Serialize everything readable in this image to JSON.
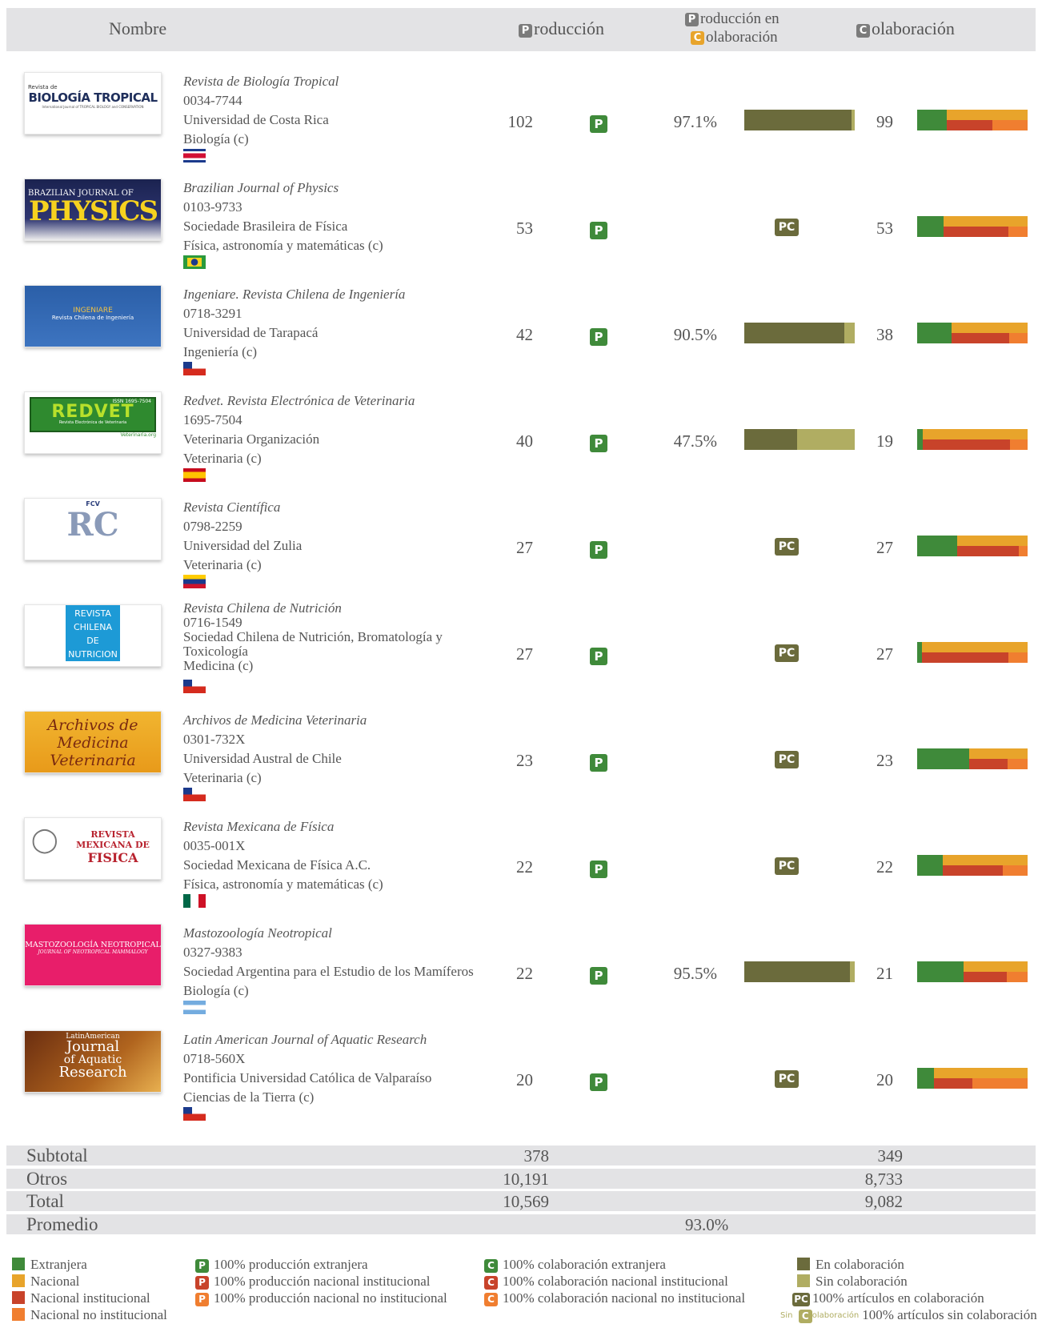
{
  "header": {
    "nombre": "Nombre",
    "produccion_badge": "P",
    "produccion": "roducción",
    "prodcolab_badge1": "P",
    "prodcolab_line1": "roducción en",
    "prodcolab_badge2": "C",
    "prodcolab_line2": "olaboración",
    "colab_badge": "C",
    "colab": "olaboración"
  },
  "badges": {
    "p": "P",
    "pc": "PC"
  },
  "journals": [
    {
      "title": "Revista de Biología Tropical",
      "issn": "0034-7744",
      "institution": "Universidad de Costa Rica",
      "area": "Biología (c)",
      "country_flag": "costa-rica-flag",
      "produccion": "102",
      "prod_colab_pct": "97.1%",
      "prod_colab_value": 0.971,
      "colaboracion": "99",
      "colab_bar": {
        "extranjera": 0.27,
        "nacional": 0.73,
        "nacional_institucional": 0.41,
        "nacional_no_institucional": 0.32
      }
    },
    {
      "title": "Brazilian Journal of Physics",
      "issn": "0103-9733",
      "institution": "Sociedade Brasileira de Física",
      "area": "Física, astronomía y matemáticas (c)",
      "country_flag": "brazil-flag",
      "produccion": "53",
      "prod_colab_pct": "",
      "prod_colab_value": 1.0,
      "colaboracion": "53",
      "colab_bar": {
        "extranjera": 0.24,
        "nacional": 0.76,
        "nacional_institucional": 0.59,
        "nacional_no_institucional": 0.17
      }
    },
    {
      "title": "Ingeniare. Revista Chilena de Ingeniería",
      "issn": "0718-3291",
      "institution": "Universidad de Tarapacá",
      "area": "Ingeniería (c)",
      "country_flag": "chile-flag",
      "produccion": "42",
      "prod_colab_pct": "90.5%",
      "prod_colab_value": 0.905,
      "colaboracion": "38",
      "colab_bar": {
        "extranjera": 0.31,
        "nacional": 0.69,
        "nacional_institucional": 0.52,
        "nacional_no_institucional": 0.17
      }
    },
    {
      "title": "Redvet. Revista Electrónica de Veterinaria",
      "issn": "1695-7504",
      "institution": "Veterinaria Organización",
      "area": "Veterinaria (c)",
      "country_flag": "spain-flag",
      "produccion": "40",
      "prod_colab_pct": "47.5%",
      "prod_colab_value": 0.475,
      "colaboracion": "19",
      "colab_bar": {
        "extranjera": 0.05,
        "nacional": 0.95,
        "nacional_institucional": 0.79,
        "nacional_no_institucional": 0.16
      }
    },
    {
      "title": "Revista Científica",
      "issn": "0798-2259",
      "institution": "Universidad del Zulia",
      "area": "Veterinaria (c)",
      "country_flag": "venezuela-flag",
      "produccion": "27",
      "prod_colab_pct": "",
      "prod_colab_value": 1.0,
      "colaboracion": "27",
      "colab_bar": {
        "extranjera": 0.36,
        "nacional": 0.64,
        "nacional_institucional": 0.56,
        "nacional_no_institucional": 0.08
      }
    },
    {
      "title": "Revista Chilena de Nutrición",
      "issn": "0716-1549",
      "institution": "Sociedad Chilena de Nutrición, Bromatología y Toxicología",
      "area": "Medicina (c)",
      "country_flag": "chile-flag",
      "produccion": "27",
      "prod_colab_pct": "",
      "prod_colab_value": 1.0,
      "colaboracion": "27",
      "colab_bar": {
        "extranjera": 0.04,
        "nacional": 0.96,
        "nacional_institucional": 0.78,
        "nacional_no_institucional": 0.18
      }
    },
    {
      "title": "Archivos de Medicina Veterinaria",
      "issn": "0301-732X",
      "institution": "Universidad Austral de Chile",
      "area": "Veterinaria (c)",
      "country_flag": "chile-flag",
      "produccion": "23",
      "prod_colab_pct": "",
      "prod_colab_value": 1.0,
      "colaboracion": "23",
      "colab_bar": {
        "extranjera": 0.47,
        "nacional": 0.53,
        "nacional_institucional": 0.35,
        "nacional_no_institucional": 0.18
      }
    },
    {
      "title": "Revista Mexicana de Física",
      "issn": "0035-001X",
      "institution": "Sociedad Mexicana de Física A.C.",
      "area": "Física, astronomía y matemáticas (c)",
      "country_flag": "mexico-flag",
      "produccion": "22",
      "prod_colab_pct": "",
      "prod_colab_value": 1.0,
      "colaboracion": "22",
      "colab_bar": {
        "extranjera": 0.23,
        "nacional": 0.77,
        "nacional_institucional": 0.54,
        "nacional_no_institucional": 0.23
      }
    },
    {
      "title": "Mastozoología Neotropical",
      "issn": "0327-9383",
      "institution": "Sociedad Argentina para el Estudio de los Mamíferos",
      "area": "Biología (c)",
      "country_flag": "argentina-flag",
      "produccion": "22",
      "prod_colab_pct": "95.5%",
      "prod_colab_value": 0.955,
      "colaboracion": "21",
      "colab_bar": {
        "extranjera": 0.42,
        "nacional": 0.58,
        "nacional_institucional": 0.39,
        "nacional_no_institucional": 0.19
      }
    },
    {
      "title": "Latin American Journal of Aquatic Research",
      "issn": "0718-560X",
      "institution": "Pontificia Universidad Católica de Valparaíso",
      "area": "Ciencias de la Tierra (c)",
      "country_flag": "chile-flag",
      "produccion": "20",
      "prod_colab_pct": "",
      "prod_colab_value": 1.0,
      "colaboracion": "20",
      "colab_bar": {
        "extranjera": 0.15,
        "nacional": 0.85,
        "nacional_institucional": 0.35,
        "nacional_no_institucional": 0.5
      }
    }
  ],
  "logos": [
    {
      "line1": "Revista de",
      "line2": "BIOLOGÍA TROPICAL",
      "line3": "International Journal of TROPICAL BIOLOGY and CONSERVATION"
    },
    {
      "line1": "BRAZILIAN JOURNAL OF",
      "line2": "PHYSICS"
    },
    {
      "line1": "INGENIARE",
      "line2": "Revista Chilena de Ingeniería"
    },
    {
      "line1": "ISSN 1695-7504",
      "line2": "REDVET",
      "line3": "Revista Electrónica de Veterinaria",
      "line4": "Veterinaria.org"
    },
    {
      "line1": "RC",
      "line2": "FCV"
    },
    {
      "line1": "REVISTA",
      "line2": "CHILENA",
      "line3": "DE",
      "line4": "NUTRICION"
    },
    {
      "line1": "Archivos de",
      "line2": "Medicina Veterinaria"
    },
    {
      "line1": "REVISTA",
      "line2": "MEXICANA DE",
      "line3": "FISICA"
    },
    {
      "line1": "MASTOZOOLOGÍA NEOTROPICAL",
      "line2": "JOURNAL OF NEOTROPICAL MAMMALOGY"
    },
    {
      "line1": "LatinAmerican",
      "line2": "Journal",
      "line3": "of Aquatic",
      "line4": "Research"
    }
  ],
  "totals": {
    "subtotal": {
      "label": "Subtotal",
      "produccion": "378",
      "colaboracion": "349"
    },
    "otros": {
      "label": "Otros",
      "produccion": "10,191",
      "colaboracion": "8,733"
    },
    "total": {
      "label": "Total",
      "produccion": "10,569",
      "colaboracion": "9,082"
    },
    "promedio": {
      "label": "Promedio",
      "value": "93.0%"
    }
  },
  "legend": {
    "col1": [
      "Extranjera",
      "Nacional",
      "Nacional institucional",
      "Nacional no institucional"
    ],
    "col2": [
      "100% producción extranjera",
      "100% producción nacional institucional",
      "100% producción nacional no institucional"
    ],
    "col3": [
      "100% colaboración extranjera",
      "100% colaboración nacional institucional",
      "100% colaboración nacional no institucional"
    ],
    "col4": [
      "En colaboración",
      "Sin colaboración",
      "100% artículos en colaboración",
      "100% artículos sin colaboración"
    ],
    "sin_prefix": "Sin",
    "sin_badge_text": "olaboración",
    "colors": {
      "green": "#3f8a3a",
      "yellow": "#e8a42b",
      "red": "#c8432a",
      "orange": "#f07e30",
      "olive": "#6b6b3c",
      "lightolive": "#b0ad62"
    }
  }
}
